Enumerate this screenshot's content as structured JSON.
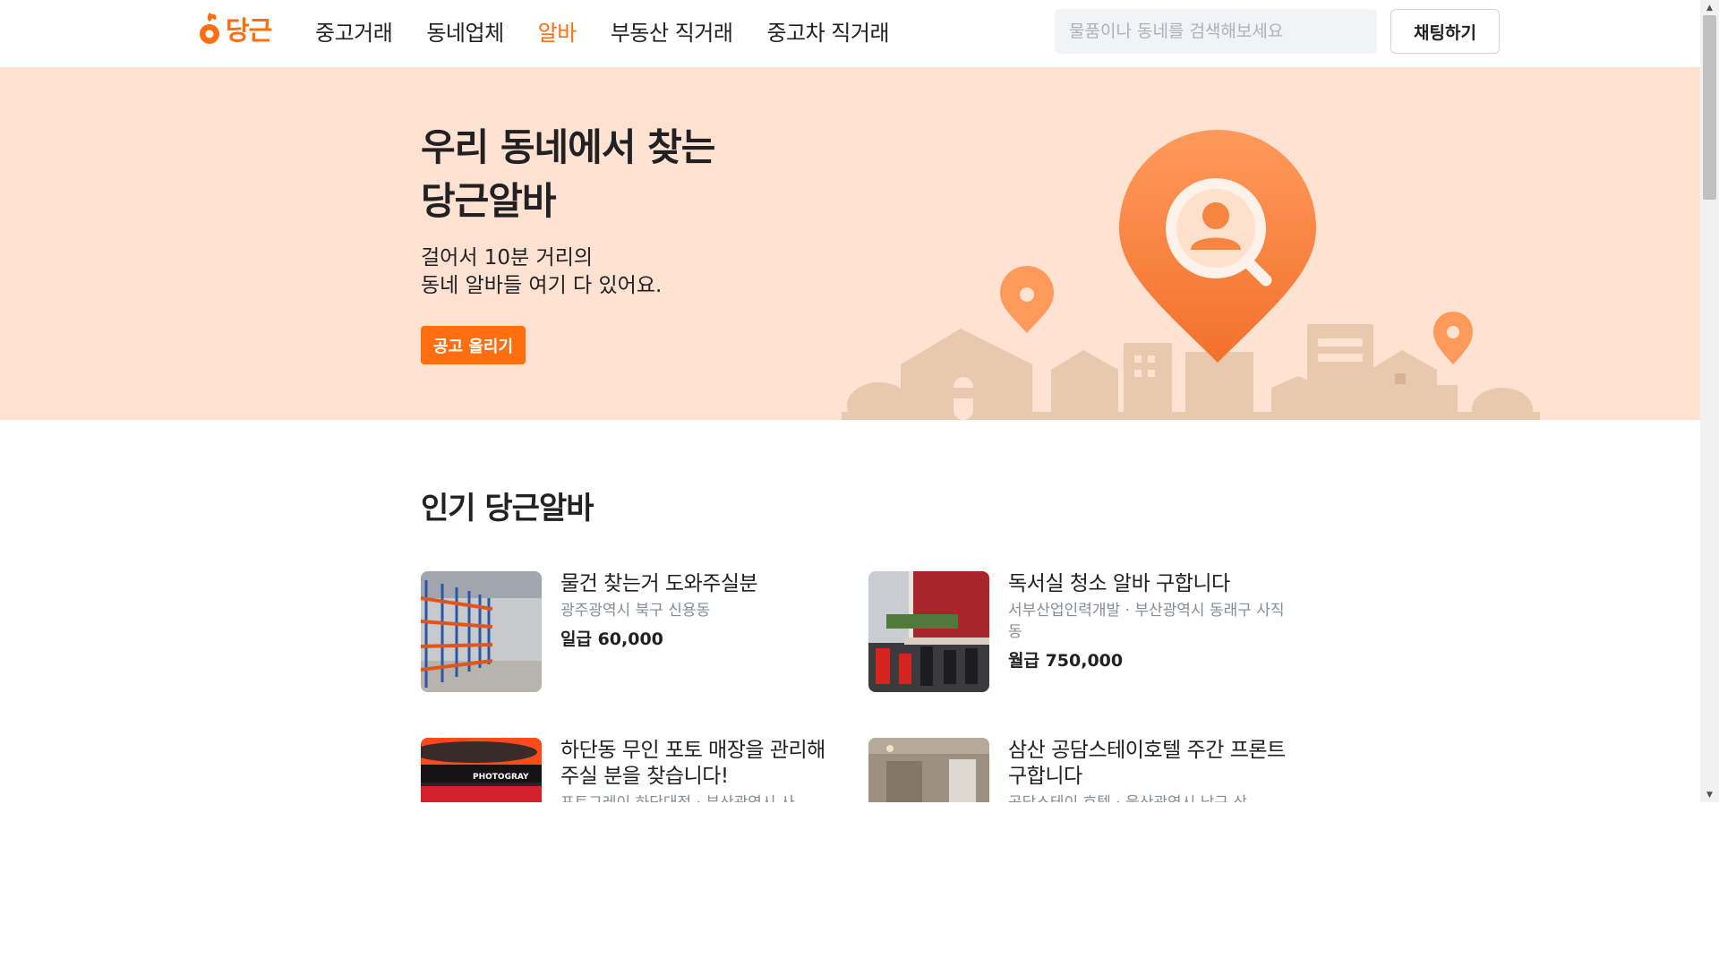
{
  "header": {
    "logo_text": "당근",
    "nav": [
      {
        "label": "중고거래",
        "active": false
      },
      {
        "label": "동네업체",
        "active": false
      },
      {
        "label": "알바",
        "active": true
      },
      {
        "label": "부동산 직거래",
        "active": false
      },
      {
        "label": "중고차 직거래",
        "active": false
      }
    ],
    "search_placeholder": "물품이나 동네를 검색해보세요",
    "chat_label": "채팅하기"
  },
  "hero": {
    "title_line1": "우리 동네에서 찾는",
    "title_line2": "당근알바",
    "sub_line1": "걸어서 10분 거리의",
    "sub_line2": "동네 알바들 여기 다 있어요.",
    "post_button": "공고 올리기"
  },
  "popular": {
    "title": "인기 당근알바",
    "items": [
      {
        "title": "물건 찾는거 도와주실분",
        "meta": "광주광역시 북구 신용동",
        "pay": "일급 60,000"
      },
      {
        "title": "독서실 청소 알바 구합니다",
        "meta": "서부산업인력개발 · 부산광역시 동래구 사직동",
        "pay": "월급 750,000"
      },
      {
        "title": "하단동 무인 포토 매장을 관리해주실 분을 찾습니다!",
        "meta": "포토그레이 하단대점 · 부산광역시 사",
        "pay": "",
        "sign_text": "PHOTOGRAY"
      },
      {
        "title": "삼산 공담스테이호텔 주간 프론트 구합니다",
        "meta": "공담스테이 호텔 · 울산광역시 남구 삼",
        "pay": ""
      }
    ]
  },
  "colors": {
    "brand": "#ff6f0f",
    "hero_bg": "#ffe2d2",
    "town_shape": "#e8c9ad"
  }
}
